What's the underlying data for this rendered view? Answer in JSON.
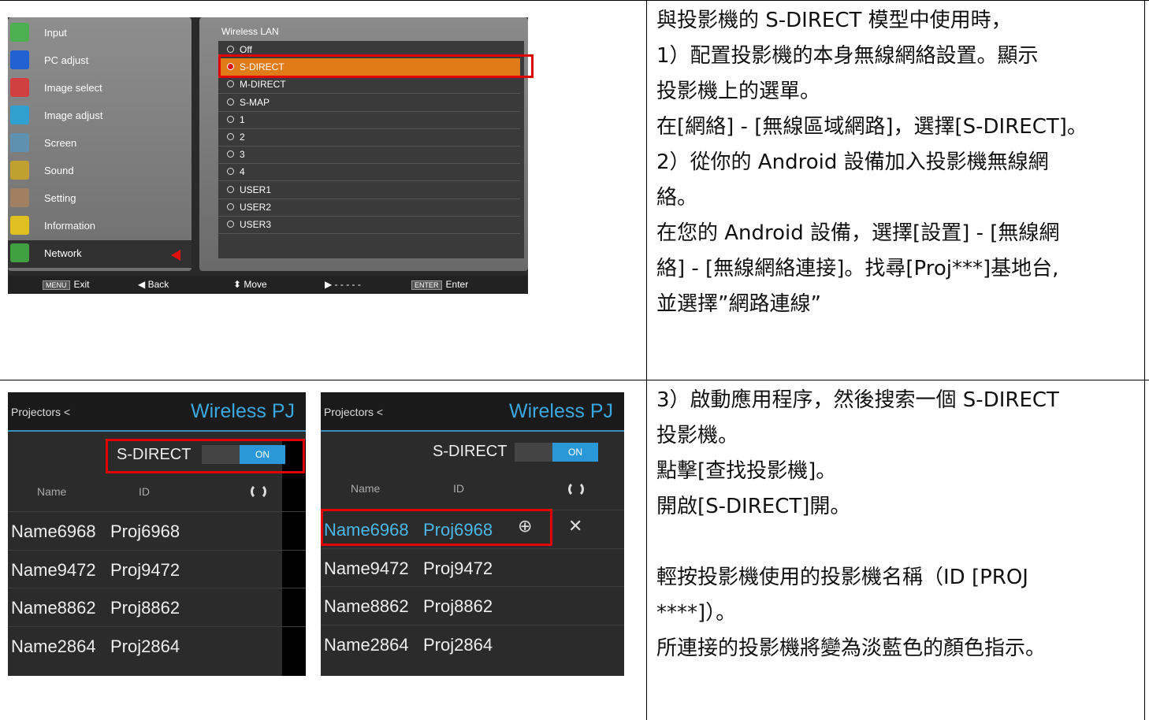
{
  "osd": {
    "menu": [
      {
        "label": "Input",
        "icon": "input-icon",
        "color": "#4caf50"
      },
      {
        "label": "PC adjust",
        "icon": "pc-adjust-icon",
        "color": "#2060d0"
      },
      {
        "label": "Image select",
        "icon": "image-select-icon",
        "color": "#d04040"
      },
      {
        "label": "Image adjust",
        "icon": "image-adjust-icon",
        "color": "#30a0d0"
      },
      {
        "label": "Screen",
        "icon": "screen-icon",
        "color": "#6090b0"
      },
      {
        "label": "Sound",
        "icon": "sound-icon",
        "color": "#c0a030"
      },
      {
        "label": "Setting",
        "icon": "setting-icon",
        "color": "#a08060"
      },
      {
        "label": "Information",
        "icon": "information-icon",
        "color": "#e0c020"
      },
      {
        "label": "Network",
        "icon": "network-icon",
        "color": "#40a040"
      }
    ],
    "panel_title": "Wireless LAN",
    "options": [
      "Off",
      "S-DIRECT",
      "M-DIRECT",
      "S-MAP",
      "1",
      "2",
      "3",
      "4",
      "USER1",
      "USER2",
      "USER3"
    ],
    "selected": "S-DIRECT",
    "footer": {
      "menu_key": "MENU",
      "exit": "Exit",
      "back": "◀ Back",
      "move": "⬍ Move",
      "dots": "▶ - - - - -",
      "enter_key": "ENTER",
      "enter": "Enter"
    }
  },
  "text1": [
    "與投影機的 S-DIRECT 模型中使用時，",
    "  1）配置投影機的本身無線網絡設置。顯示",
    "投影機上的選單。",
    "在[網絡] - [無線區域網路]，選擇[S-DIRECT]。",
    "2）從你的 Android 設備加入投影機無線網",
    "絡。",
    "在您的 Android 設備，選擇[設置] - [無線網",
    "絡] - [無線網絡連接]。找尋[Proj***]基地台,",
    "並選擇”網路連線”"
  ],
  "text2": [
    "3）啟動應用程序，然後搜索一個 S-DIRECT",
    "投影機。",
    "點擊[查找投影機]。",
    "開啟[S-DIRECT]開。",
    "",
    "輕按投影機使用的投影機名稱（ID [PROJ",
    "****]）。",
    "所連接的投影機將變為淡藍色的顏色指示。"
  ],
  "phone": {
    "projectors": "Projectors <",
    "title": "Wireless PJ",
    "sdirect": "S-DIRECT",
    "on": "ON",
    "col_name": "Name",
    "col_id": "ID",
    "rows": [
      {
        "name": "Name6968",
        "id": "Proj6968"
      },
      {
        "name": "Name9472",
        "id": "Proj9472"
      },
      {
        "name": "Name8862",
        "id": "Proj8862"
      },
      {
        "name": "Name2864",
        "id": "Proj2864"
      }
    ],
    "close": "✕"
  }
}
